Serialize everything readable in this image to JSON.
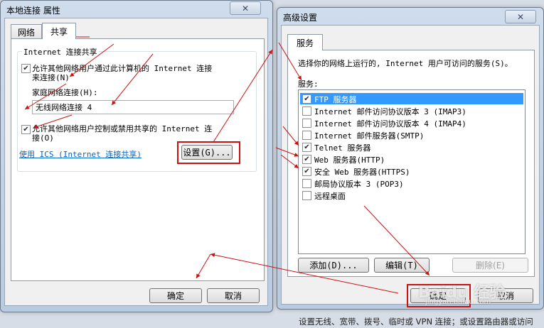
{
  "props_window": {
    "title": "本地连接 属性",
    "tabs": [
      "网络",
      "共享"
    ],
    "group_title": "Internet 连接共享",
    "allow_connect_line1": "允许其他网络用户通过此计算机的 Internet 连接",
    "allow_connect_line2": "来连接(N)",
    "home_network_label": "家庭网络连接(H):",
    "home_network_value": "无线网络连接 4",
    "allow_control_line1": "允许其他网络用户控制或禁用共享的 Internet 连",
    "allow_control_line2": "接(O)",
    "ics_link": "使用 ICS (Internet 连接共享)",
    "settings_button": "设置(G)...",
    "ok_button": "确定",
    "cancel_button": "取消"
  },
  "advanced_window": {
    "title": "高级设置",
    "tab": "服务",
    "description": "选择你的网络上运行的, Internet 用户可访问的服务(S)。",
    "services_label": "服务:",
    "services": [
      {
        "label": "FTP 服务器",
        "checked": true,
        "selected": true
      },
      {
        "label": "Internet 邮件访问协议版本 3 (IMAP3)",
        "checked": false,
        "selected": false
      },
      {
        "label": "Internet 邮件访问协议版本 4 (IMAP4)",
        "checked": false,
        "selected": false
      },
      {
        "label": "Internet 邮件服务器(SMTP)",
        "checked": false,
        "selected": false
      },
      {
        "label": "Telnet 服务器",
        "checked": true,
        "selected": false
      },
      {
        "label": "Web 服务器(HTTP)",
        "checked": true,
        "selected": false
      },
      {
        "label": "安全 Web 服务器(HTTPS)",
        "checked": true,
        "selected": false
      },
      {
        "label": "邮局协议版本 3 (POP3)",
        "checked": false,
        "selected": false
      },
      {
        "label": "远程桌面",
        "checked": false,
        "selected": false
      }
    ],
    "add_button": "添加(D)...",
    "edit_button": "编辑(T)",
    "delete_button": "删除(E)",
    "ok_button": "确定",
    "cancel_button": "取消"
  },
  "background": {
    "status_text": "设置无线、宽带、拨号、临时或 VPN 连接；或设置路由器或访问"
  },
  "watermark": {
    "text": "Baidu 经验",
    "subtext": "jingyan.baidu.com"
  },
  "colors": {
    "annotation_red": "#cc1111",
    "selection_blue": "#3399ff",
    "link_blue": "#0066cc"
  },
  "icons": {
    "close": "close-icon",
    "check": "check-icon"
  }
}
